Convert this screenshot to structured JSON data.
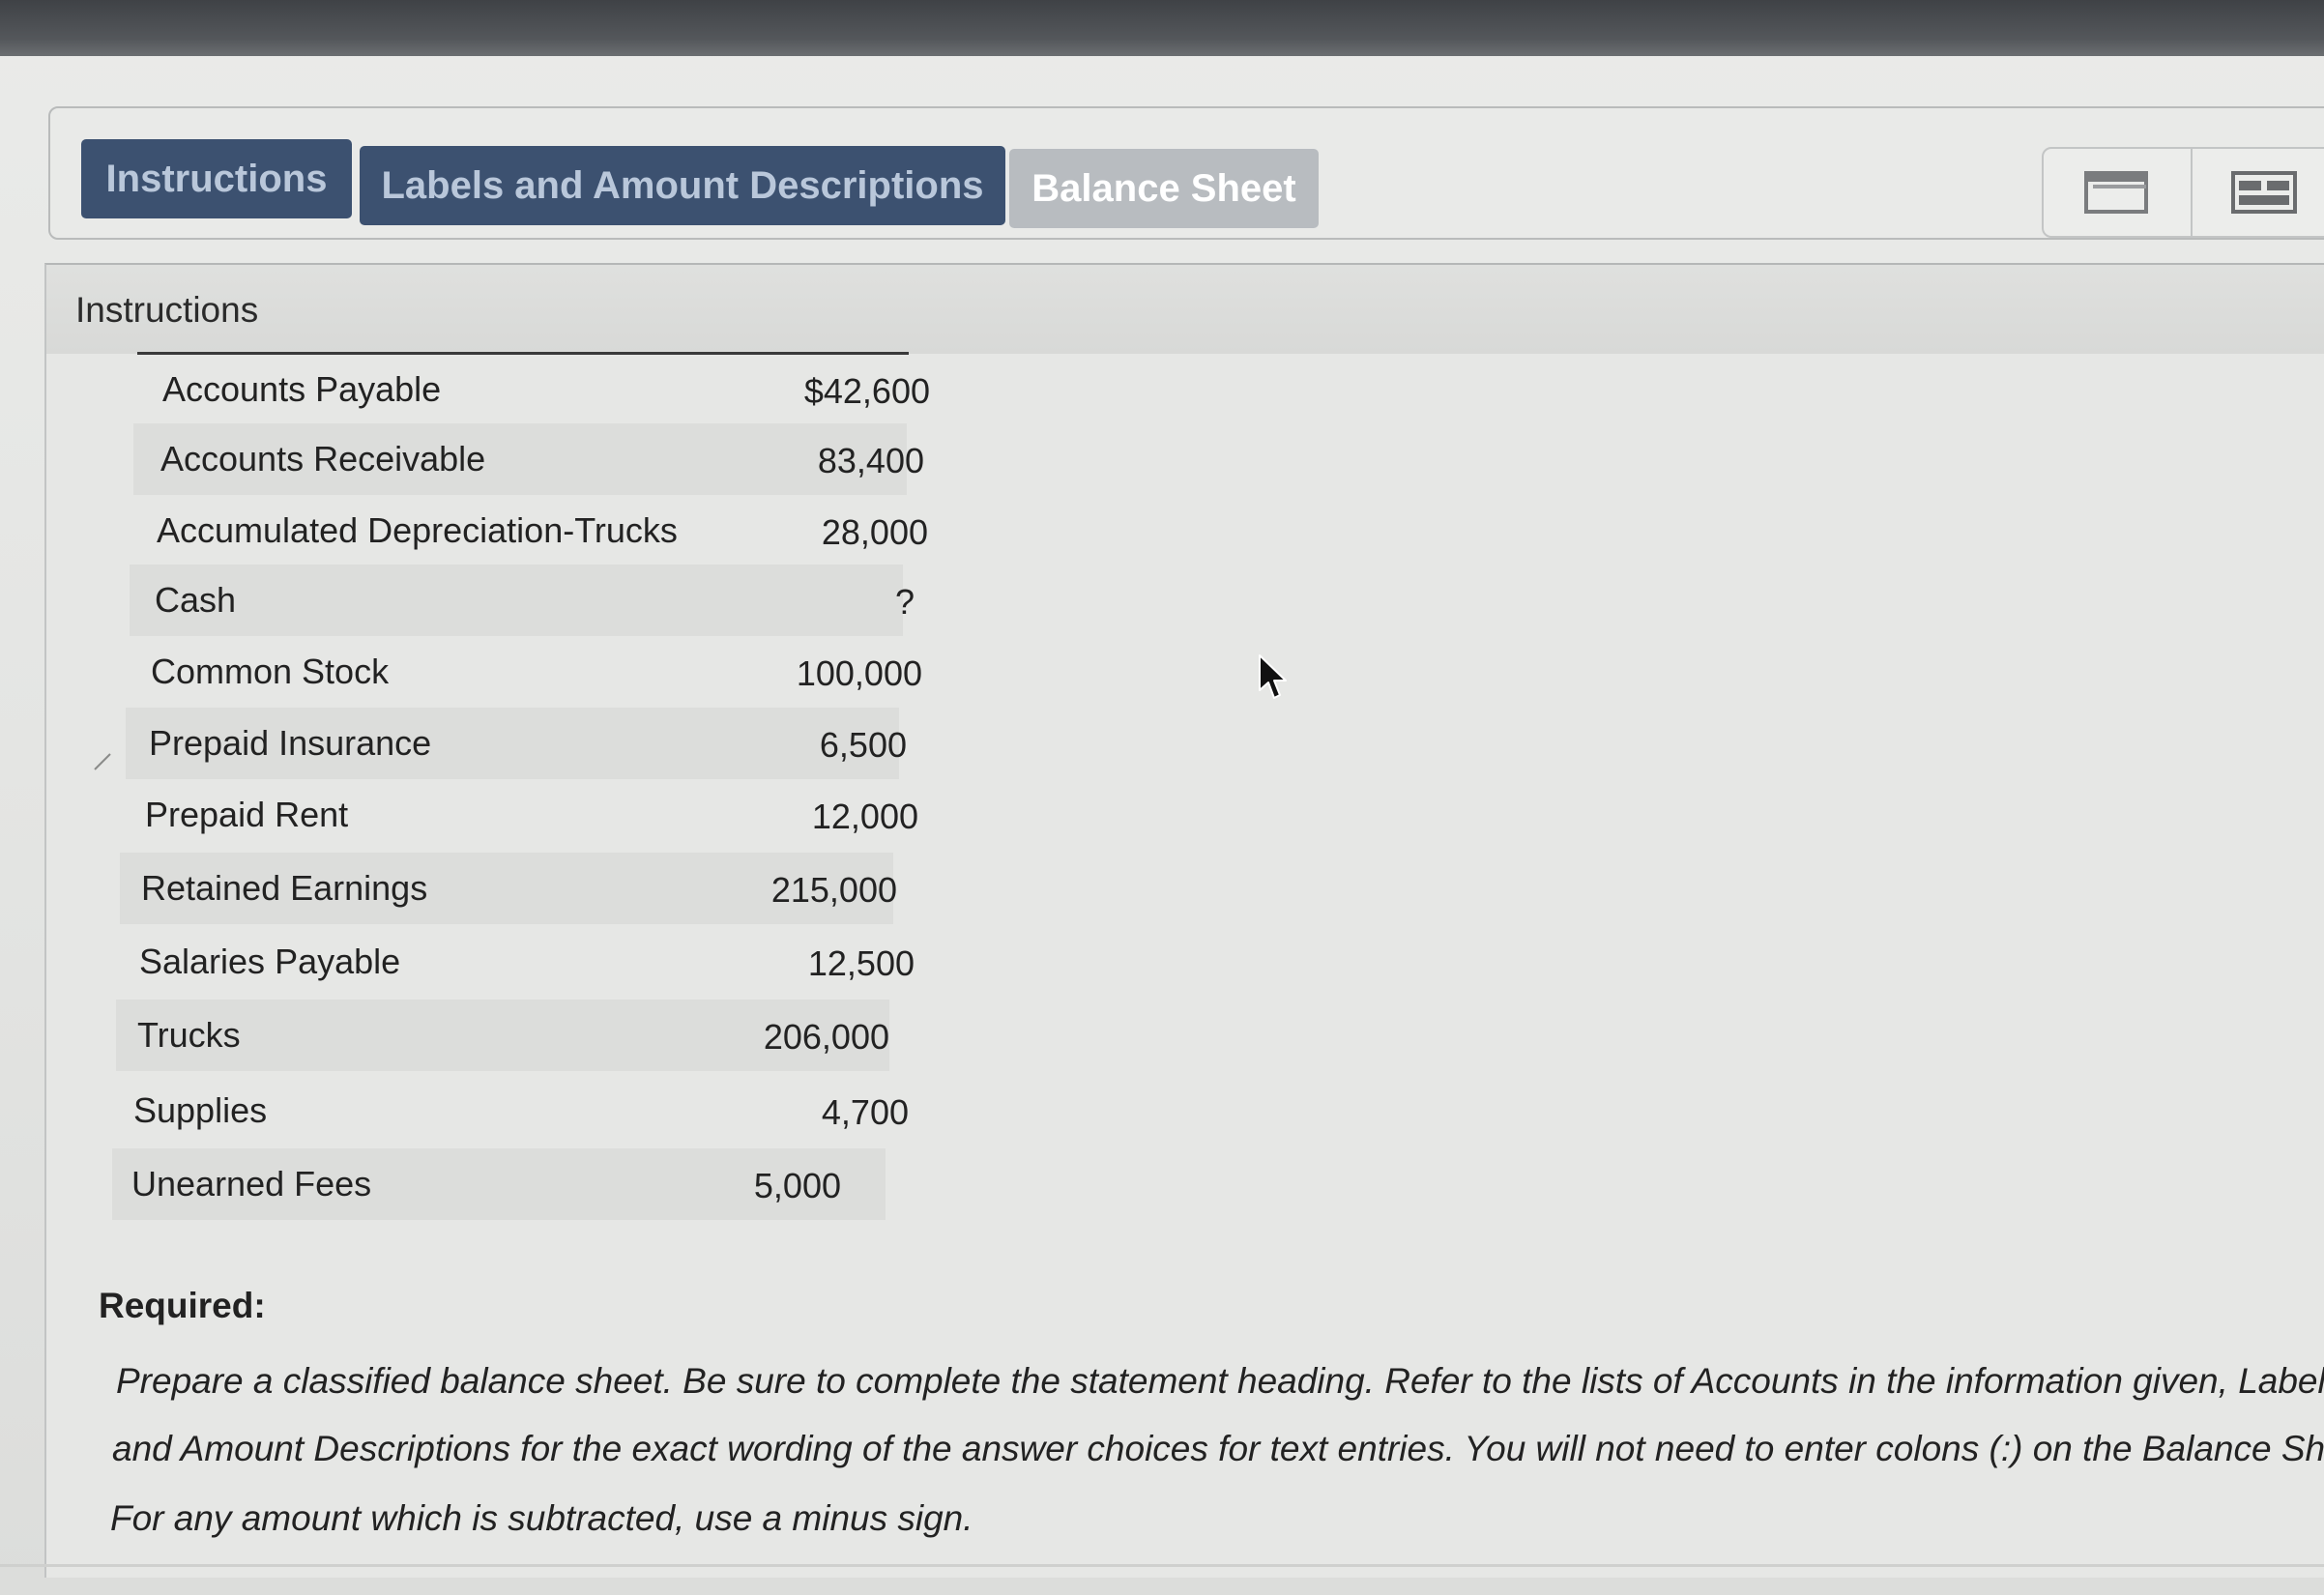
{
  "tabs": [
    {
      "label": "Instructions"
    },
    {
      "label": "Labels and Amount Descriptions"
    },
    {
      "label": "Balance Sheet"
    }
  ],
  "view_toggle": {
    "single_icon": "single-window-icon",
    "split_icon": "split-view-icon"
  },
  "panel": {
    "title": "Instructions"
  },
  "accounts": [
    {
      "name": "Accounts Payable",
      "amount": "$42,600"
    },
    {
      "name": "Accounts Receivable",
      "amount": "83,400"
    },
    {
      "name": "Accumulated Depreciation-Trucks",
      "amount": "28,000"
    },
    {
      "name": "Cash",
      "amount": "?"
    },
    {
      "name": "Common Stock",
      "amount": "100,000"
    },
    {
      "name": "Prepaid Insurance",
      "amount": "6,500"
    },
    {
      "name": "Prepaid Rent",
      "amount": "12,000"
    },
    {
      "name": "Retained Earnings",
      "amount": "215,000"
    },
    {
      "name": "Salaries Payable",
      "amount": "12,500"
    },
    {
      "name": "Trucks",
      "amount": "206,000"
    },
    {
      "name": "Supplies",
      "amount": "4,700"
    },
    {
      "name": "Unearned Fees",
      "amount": "5,000"
    }
  ],
  "required": {
    "label": "Required:",
    "lines": [
      "Prepare a classified balance sheet. Be sure to complete the statement heading. Refer to the lists of Accounts in the information given, Labels,",
      "and Amount Descriptions for the exact wording of the answer choices for text entries. You will not need to enter colons (:) on the Balance Sheet.",
      "For any amount which is subtracted, use a minus sign."
    ]
  },
  "colors": {
    "tab_active": "#3c5170",
    "tab_inactive": "#b8bcc0",
    "background": "#e6e7e5"
  }
}
